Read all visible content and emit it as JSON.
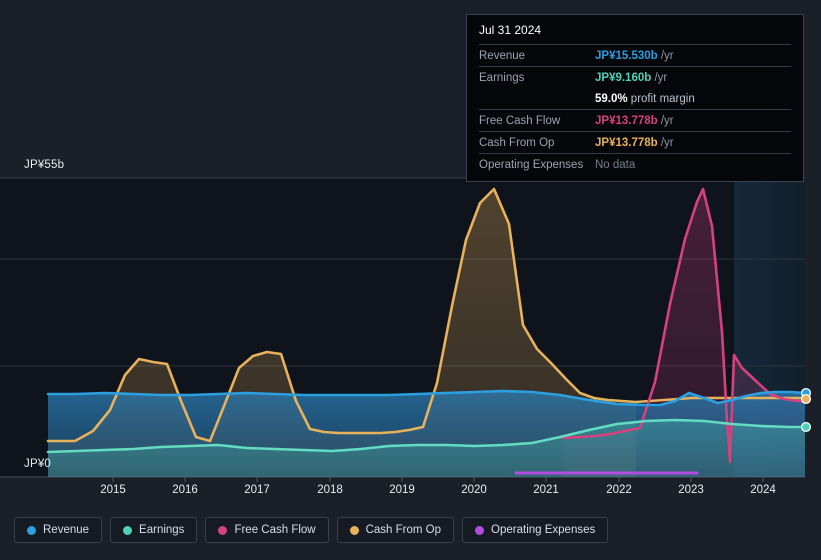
{
  "tooltip": {
    "date": "Jul 31 2024",
    "rows": [
      {
        "name": "Revenue",
        "value": "JP¥15.530b",
        "unit": " /yr",
        "color": "#2b9fe0"
      },
      {
        "name": "Earnings",
        "value": "JP¥9.160b",
        "unit": " /yr",
        "color": "#4fd1b9"
      },
      {
        "name": "Free Cash Flow",
        "value": "JP¥13.778b",
        "unit": " /yr",
        "color": "#d6417f"
      },
      {
        "name": "Cash From Op",
        "value": "JP¥13.778b",
        "unit": " /yr",
        "color": "#e8b15c"
      },
      {
        "name": "Operating Expenses",
        "value": "No data",
        "unit": "",
        "color": "#b44ce0"
      }
    ],
    "margin_pct": "59.0%",
    "margin_label": " profit margin"
  },
  "axis": {
    "y_top": "JP¥55b",
    "y_bottom": "JP¥0",
    "x_ticks": [
      "2015",
      "2016",
      "2017",
      "2018",
      "2019",
      "2020",
      "2021",
      "2022",
      "2023",
      "2024"
    ]
  },
  "legend": [
    {
      "label": "Revenue",
      "color": "#2b9fe0"
    },
    {
      "label": "Earnings",
      "color": "#4fd1b9"
    },
    {
      "label": "Free Cash Flow",
      "color": "#d6417f"
    },
    {
      "label": "Cash From Op",
      "color": "#e8b15c"
    },
    {
      "label": "Operating Expenses",
      "color": "#b44ce0"
    }
  ],
  "chart_data": {
    "type": "area",
    "title": "",
    "xlabel": "",
    "ylabel": "JP¥ (billions)",
    "ylim": [
      0,
      55
    ],
    "xlim": [
      2014.45,
      2024.95
    ],
    "grid": true,
    "currency": "JP¥",
    "units": "billions per year",
    "y_ticks": [
      0,
      55
    ],
    "y_gridlines": [
      0,
      18.3,
      37.0,
      55
    ],
    "legend_position": "bottom",
    "forecast_region": {
      "start": 2023.6,
      "end": 2024.95,
      "label": "forecast-shading"
    },
    "x": [
      2014.45,
      2014.8,
      2015.0,
      2015.3,
      2015.6,
      2015.85,
      2016.1,
      2016.35,
      2016.6,
      2016.85,
      2017.1,
      2017.35,
      2017.6,
      2017.85,
      2018.1,
      2018.35,
      2018.6,
      2018.85,
      2019.1,
      2019.35,
      2019.6,
      2019.85,
      2020.1,
      2020.35,
      2020.6,
      2020.85,
      2021.1,
      2021.35,
      2021.6,
      2021.85,
      2022.1,
      2022.35,
      2022.6,
      2022.85,
      2023.1,
      2023.35,
      2023.6,
      2023.85,
      2024.1,
      2024.35,
      2024.6,
      2024.85
    ],
    "series": [
      {
        "name": "Revenue",
        "color": "#2b9fe0",
        "values": [
          15.3,
          15.3,
          15.4,
          15.5,
          15.4,
          15.3,
          15.3,
          15.2,
          15.2,
          15.3,
          15.4,
          15.3,
          15.2,
          15.1,
          15.1,
          15.1,
          15.2,
          15.2,
          15.3,
          15.3,
          15.3,
          15.3,
          15.3,
          15.3,
          15.4,
          15.5,
          15.6,
          15.4,
          15.1,
          14.8,
          14.5,
          14.4,
          14.4,
          15.2,
          14.9,
          14.7,
          15.0,
          15.3,
          15.5,
          15.6,
          15.6,
          15.53
        ],
        "end_value": 15.53
      },
      {
        "name": "Earnings",
        "color": "#4fd1b9",
        "values": [
          4.5,
          4.5,
          4.6,
          4.7,
          4.8,
          4.9,
          5.0,
          5.1,
          5.3,
          5.4,
          5.5,
          5.4,
          5.3,
          5.2,
          5.1,
          5.0,
          5.0,
          5.1,
          5.3,
          5.5,
          5.7,
          5.8,
          5.9,
          5.9,
          5.8,
          5.8,
          5.9,
          6.2,
          6.9,
          7.6,
          8.2,
          8.5,
          8.6,
          8.6,
          8.7,
          8.5,
          8.1,
          8.2,
          8.5,
          8.8,
          9.0,
          9.16
        ],
        "end_value": 9.16
      },
      {
        "name": "Free Cash Flow",
        "color": "#d6417f",
        "values": [
          null,
          null,
          null,
          null,
          null,
          null,
          null,
          null,
          null,
          null,
          null,
          null,
          null,
          null,
          null,
          null,
          null,
          null,
          null,
          null,
          null,
          7.2,
          7.4,
          7.6,
          7.8,
          8.1,
          9.0,
          17.0,
          31.0,
          43.0,
          50.0,
          52.8,
          46.0,
          22.0,
          1.5,
          17.0,
          14.5,
          14.2,
          14.0,
          13.9,
          13.8,
          13.778
        ],
        "end_value": 13.778,
        "note": "sharp collapse to near zero in early 2023 then rebound"
      },
      {
        "name": "Cash From Op",
        "color": "#e8b15c",
        "values": [
          6.6,
          6.6,
          6.7,
          8.5,
          12.5,
          18.8,
          21.8,
          21.3,
          20.9,
          14.0,
          7.3,
          6.6,
          13.0,
          20.0,
          22.2,
          23.0,
          22.6,
          14.0,
          8.9,
          8.4,
          8.3,
          8.3,
          8.3,
          8.3,
          8.4,
          8.6,
          9.2,
          17.3,
          31.5,
          43.5,
          50.5,
          53.0,
          46.5,
          28.0,
          23.5,
          21.0,
          18.0,
          15.5,
          14.6,
          14.2,
          14.0,
          13.778
        ],
        "end_value": 13.778
      },
      {
        "name": "Operating Expenses",
        "color": "#b44ce0",
        "values": [
          null,
          null,
          null,
          null,
          null,
          null,
          null,
          null,
          null,
          null,
          null,
          null,
          null,
          null,
          null,
          null,
          null,
          null,
          null,
          null,
          null,
          null,
          null,
          null,
          0.0,
          0.0,
          0.0,
          0.0,
          0.0,
          0.0,
          0.0,
          0.0,
          0.0,
          0.0,
          null,
          null,
          null,
          null,
          null,
          null,
          null,
          null
        ],
        "end_value": null,
        "note": "flat at zero from mid-2020 to early 2023; No data at Jul 31 2024"
      }
    ],
    "annotations": [
      {
        "label": "selected point",
        "x": 2024.6,
        "series": [
          "Revenue",
          "Earnings",
          "Cash From Op"
        ]
      }
    ]
  }
}
